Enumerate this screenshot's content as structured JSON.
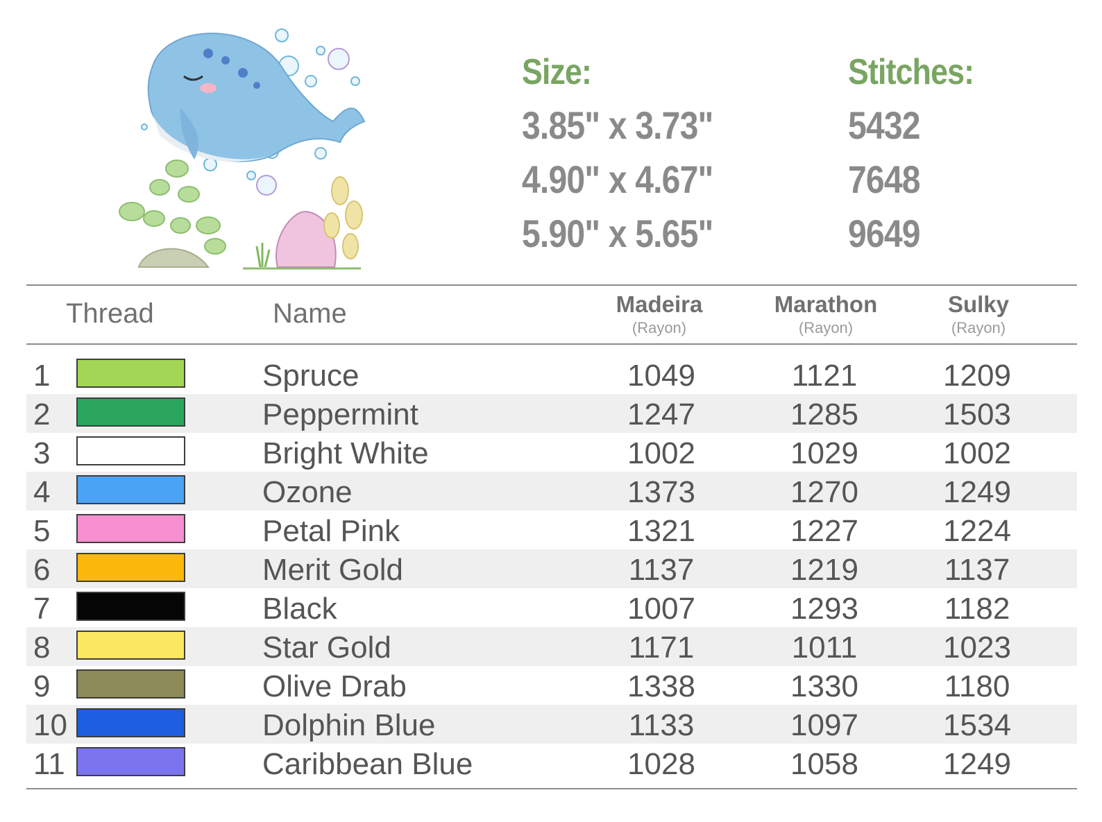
{
  "specs": {
    "size_label": "Size:",
    "stitches_label": "Stitches:",
    "rows": [
      {
        "size": "3.85\" x 3.73\"",
        "stitches": "5432"
      },
      {
        "size": "4.90\" x 4.67\"",
        "stitches": "7648"
      },
      {
        "size": "5.90\" x 5.65\"",
        "stitches": "9649"
      }
    ]
  },
  "table": {
    "headers": {
      "thread": "Thread",
      "name": "Name",
      "madeira": "Madeira",
      "madeira_sub": "(Rayon)",
      "marathon": "Marathon",
      "marathon_sub": "(Rayon)",
      "sulky": "Sulky",
      "sulky_sub": "(Rayon)"
    },
    "rows": [
      {
        "num": "1",
        "color": "#a4d656",
        "name": "Spruce",
        "madeira": "1049",
        "marathon": "1121",
        "sulky": "1209"
      },
      {
        "num": "2",
        "color": "#2aa65e",
        "name": "Peppermint",
        "madeira": "1247",
        "marathon": "1285",
        "sulky": "1503"
      },
      {
        "num": "3",
        "color": "#ffffff",
        "name": "Bright White",
        "madeira": "1002",
        "marathon": "1029",
        "sulky": "1002"
      },
      {
        "num": "4",
        "color": "#4ba3f3",
        "name": "Ozone",
        "madeira": "1373",
        "marathon": "1270",
        "sulky": "1249"
      },
      {
        "num": "5",
        "color": "#f68fcf",
        "name": "Petal Pink",
        "madeira": "1321",
        "marathon": "1227",
        "sulky": "1224"
      },
      {
        "num": "6",
        "color": "#fdb80c",
        "name": "Merit Gold",
        "madeira": "1137",
        "marathon": "1219",
        "sulky": "1137"
      },
      {
        "num": "7",
        "color": "#050505",
        "name": "Black",
        "madeira": "1007",
        "marathon": "1293",
        "sulky": "1182"
      },
      {
        "num": "8",
        "color": "#fbe860",
        "name": "Star Gold",
        "madeira": "1171",
        "marathon": "1011",
        "sulky": "1023"
      },
      {
        "num": "9",
        "color": "#8c8a56",
        "name": "Olive Drab",
        "madeira": "1338",
        "marathon": "1330",
        "sulky": "1180"
      },
      {
        "num": "10",
        "color": "#1e5ee0",
        "name": "Dolphin Blue",
        "madeira": "1133",
        "marathon": "1097",
        "sulky": "1534"
      },
      {
        "num": "11",
        "color": "#7b74ee",
        "name": "Caribbean Blue",
        "madeira": "1028",
        "marathon": "1058",
        "sulky": "1249"
      }
    ]
  }
}
